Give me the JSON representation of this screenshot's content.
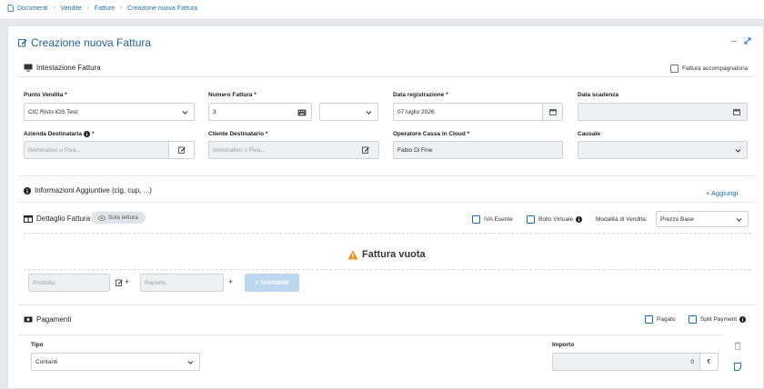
{
  "breadcrumb": {
    "items": [
      "Documenti",
      "Vendite",
      "Fatture",
      "Creazione nuova Fattura"
    ]
  },
  "page": {
    "title": "Creazione nuova Fattura"
  },
  "intestazione": {
    "section_title": "Intestazione Fattura",
    "accompagnatoria_label": "Fattura accompagnatoria",
    "punto_vendita": {
      "label": "Punto Vendita *",
      "value": "CIC Risto iOS Test"
    },
    "numero_fattura": {
      "label": "Numero Fattura *",
      "value": "3"
    },
    "data_registrazione": {
      "label": "Data registrazione *",
      "value": "07 luglio 2026"
    },
    "data_scadenza": {
      "label": "Data scadenza",
      "value": ""
    },
    "azienda_destinataria": {
      "label": "Azienda Destinataria",
      "required": "*",
      "placeholder": "Nominativo o Piva..."
    },
    "cliente_destinatario": {
      "label": "Cliente Destinatario *",
      "placeholder": "Nominativo o Piva..."
    },
    "operatore_cassa": {
      "label": "Operatore Cassa in Cloud *",
      "value": "Fabio Di Fine"
    },
    "causale": {
      "label": "Causale",
      "value": ""
    }
  },
  "info_aggiuntive": {
    "title": "Informazioni Aggiuntive (cig, cup, ...)",
    "add_label": "+ Aggiungi"
  },
  "dettaglio": {
    "title": "Dettaglio Fattura",
    "badge": "Sola lettura",
    "iva_esente": "IVA Esente",
    "bollo_virtuale": "Bollo Virtuale",
    "modalita_label": "Modalità di Vendita:",
    "modalita_value": "Prezzo Base",
    "empty_message": "Fattura vuota",
    "prodotto_placeholder": "Prodotto",
    "reparto_placeholder": "Reparto",
    "plus": "+",
    "subtotale": "+ Subtotale"
  },
  "pagamenti": {
    "title": "Pagamenti",
    "pagato": "Pagato",
    "split_payment": "Split Payment",
    "tipo_label": "Tipo",
    "tipo_value": "Contanti",
    "importo_label": "Importo",
    "importo_value": "0",
    "currency": "€"
  }
}
